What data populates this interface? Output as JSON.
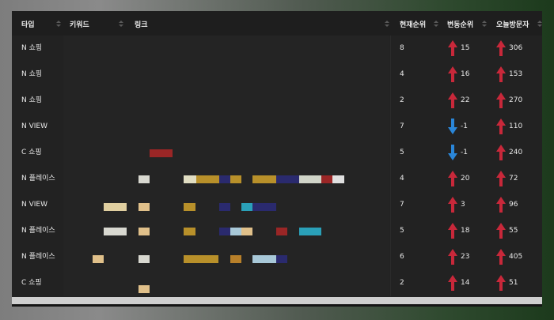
{
  "columns": {
    "type": "타입",
    "keyword": "키워드",
    "link": "링크",
    "current_rank": "현재순위",
    "change_rank": "변동순위",
    "visitors": "오늘방문자"
  },
  "rows": [
    {
      "type": "N 쇼핑",
      "current": "8",
      "change": "15",
      "change_dir": "up",
      "visitors": "306"
    },
    {
      "type": "N 쇼핑",
      "current": "4",
      "change": "16",
      "change_dir": "up",
      "visitors": "153"
    },
    {
      "type": "N 쇼핑",
      "current": "2",
      "change": "22",
      "change_dir": "up",
      "visitors": "270"
    },
    {
      "type": "N VIEW",
      "current": "7",
      "change": "-1",
      "change_dir": "down",
      "visitors": "110"
    },
    {
      "type": "C 쇼핑",
      "current": "5",
      "change": "-1",
      "change_dir": "down",
      "visitors": "240"
    },
    {
      "type": "N 플레이스",
      "current": "4",
      "change": "20",
      "change_dir": "up",
      "visitors": "72"
    },
    {
      "type": "N VIEW",
      "current": "7",
      "change": "3",
      "change_dir": "up",
      "visitors": "96"
    },
    {
      "type": "N 플레이스",
      "current": "5",
      "change": "18",
      "change_dir": "up",
      "visitors": "55"
    },
    {
      "type": "N 플레이스",
      "current": "6",
      "change": "23",
      "change_dir": "up",
      "visitors": "405"
    },
    {
      "type": "C 쇼핑",
      "current": "2",
      "change": "14",
      "change_dir": "up",
      "visitors": "51"
    }
  ],
  "colors": {
    "up_arrow": "#c8283a",
    "down_arrow": "#2a86d8",
    "row_bg": "#222222",
    "header_bg": "#1e1e1e"
  }
}
